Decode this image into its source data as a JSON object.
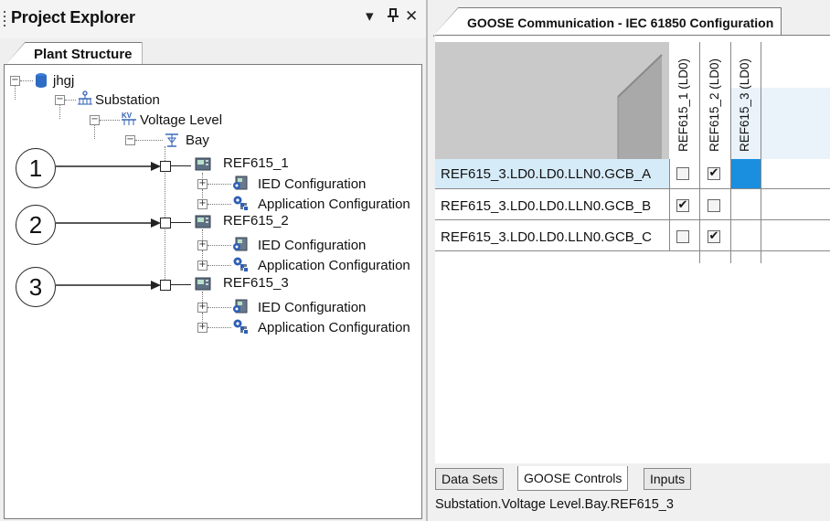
{
  "project_explorer": {
    "title": "Project Explorer",
    "controls": {
      "dropdown": "▾",
      "pin": "⊥",
      "close": "✕"
    },
    "tab_label": "Plant Structure"
  },
  "tree": {
    "root": "jhgj",
    "substation": "Substation",
    "voltage_level": "Voltage Level",
    "bay": "Bay",
    "ieds": [
      {
        "name": "REF615_1",
        "children": [
          "IED Configuration",
          "Application Configuration"
        ]
      },
      {
        "name": "REF615_2",
        "children": [
          "IED Configuration",
          "Application Configuration"
        ]
      },
      {
        "name": "REF615_3",
        "children": [
          "IED Configuration",
          "Application Configuration"
        ]
      }
    ],
    "callouts": [
      "1",
      "2",
      "3"
    ]
  },
  "goose": {
    "tab_label": "GOOSE Communication - IEC 61850 Configuration",
    "columns": [
      "REF615_1 (LD0)",
      "REF615_2 (LD0)",
      "REF615_3 (LD0)"
    ],
    "rows": [
      {
        "label": "REF615_3.LD0.LD0.LLN0.GCB_A",
        "checks": [
          false,
          true
        ],
        "selected": true
      },
      {
        "label": "REF615_3.LD0.LD0.LLN0.GCB_B",
        "checks": [
          true,
          false
        ],
        "selected": false
      },
      {
        "label": "REF615_3.LD0.LD0.LLN0.GCB_C",
        "checks": [
          false,
          true
        ],
        "selected": false
      }
    ],
    "bottom_tabs": [
      "Data Sets",
      "GOOSE Controls",
      "Inputs"
    ],
    "active_bottom_tab": "GOOSE Controls",
    "status": "Substation.Voltage Level.Bay.REF615_3"
  },
  "colors": {
    "selection": "#1a8fe0",
    "row_highlight": "#d6ebf8",
    "header_fill": "#c9c9c9"
  }
}
